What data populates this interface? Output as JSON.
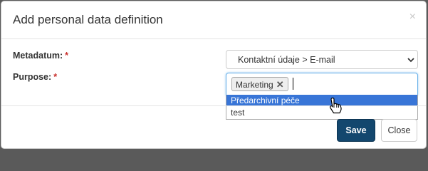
{
  "modal": {
    "title": "Add personal data definition",
    "close_glyph": "×"
  },
  "form": {
    "metadatum": {
      "label": "Metadatum:",
      "required_mark": "*",
      "selected_value": "Kontaktní údaje > E-mail"
    },
    "purpose": {
      "label": "Purpose:",
      "required_mark": "*",
      "tags": [
        "Marketing"
      ],
      "tag_remove_glyph": "✕",
      "options": [
        "Předarchivní péče",
        "test"
      ],
      "highlighted_option_index": 0
    }
  },
  "footer": {
    "save_label": "Save",
    "close_label": "Close"
  },
  "colors": {
    "primary": "#13476e",
    "highlight": "#3875d7",
    "required": "#c9302c"
  },
  "icons": {
    "chevron": "chevron-down-icon",
    "pointer": "hand-pointer-icon"
  }
}
